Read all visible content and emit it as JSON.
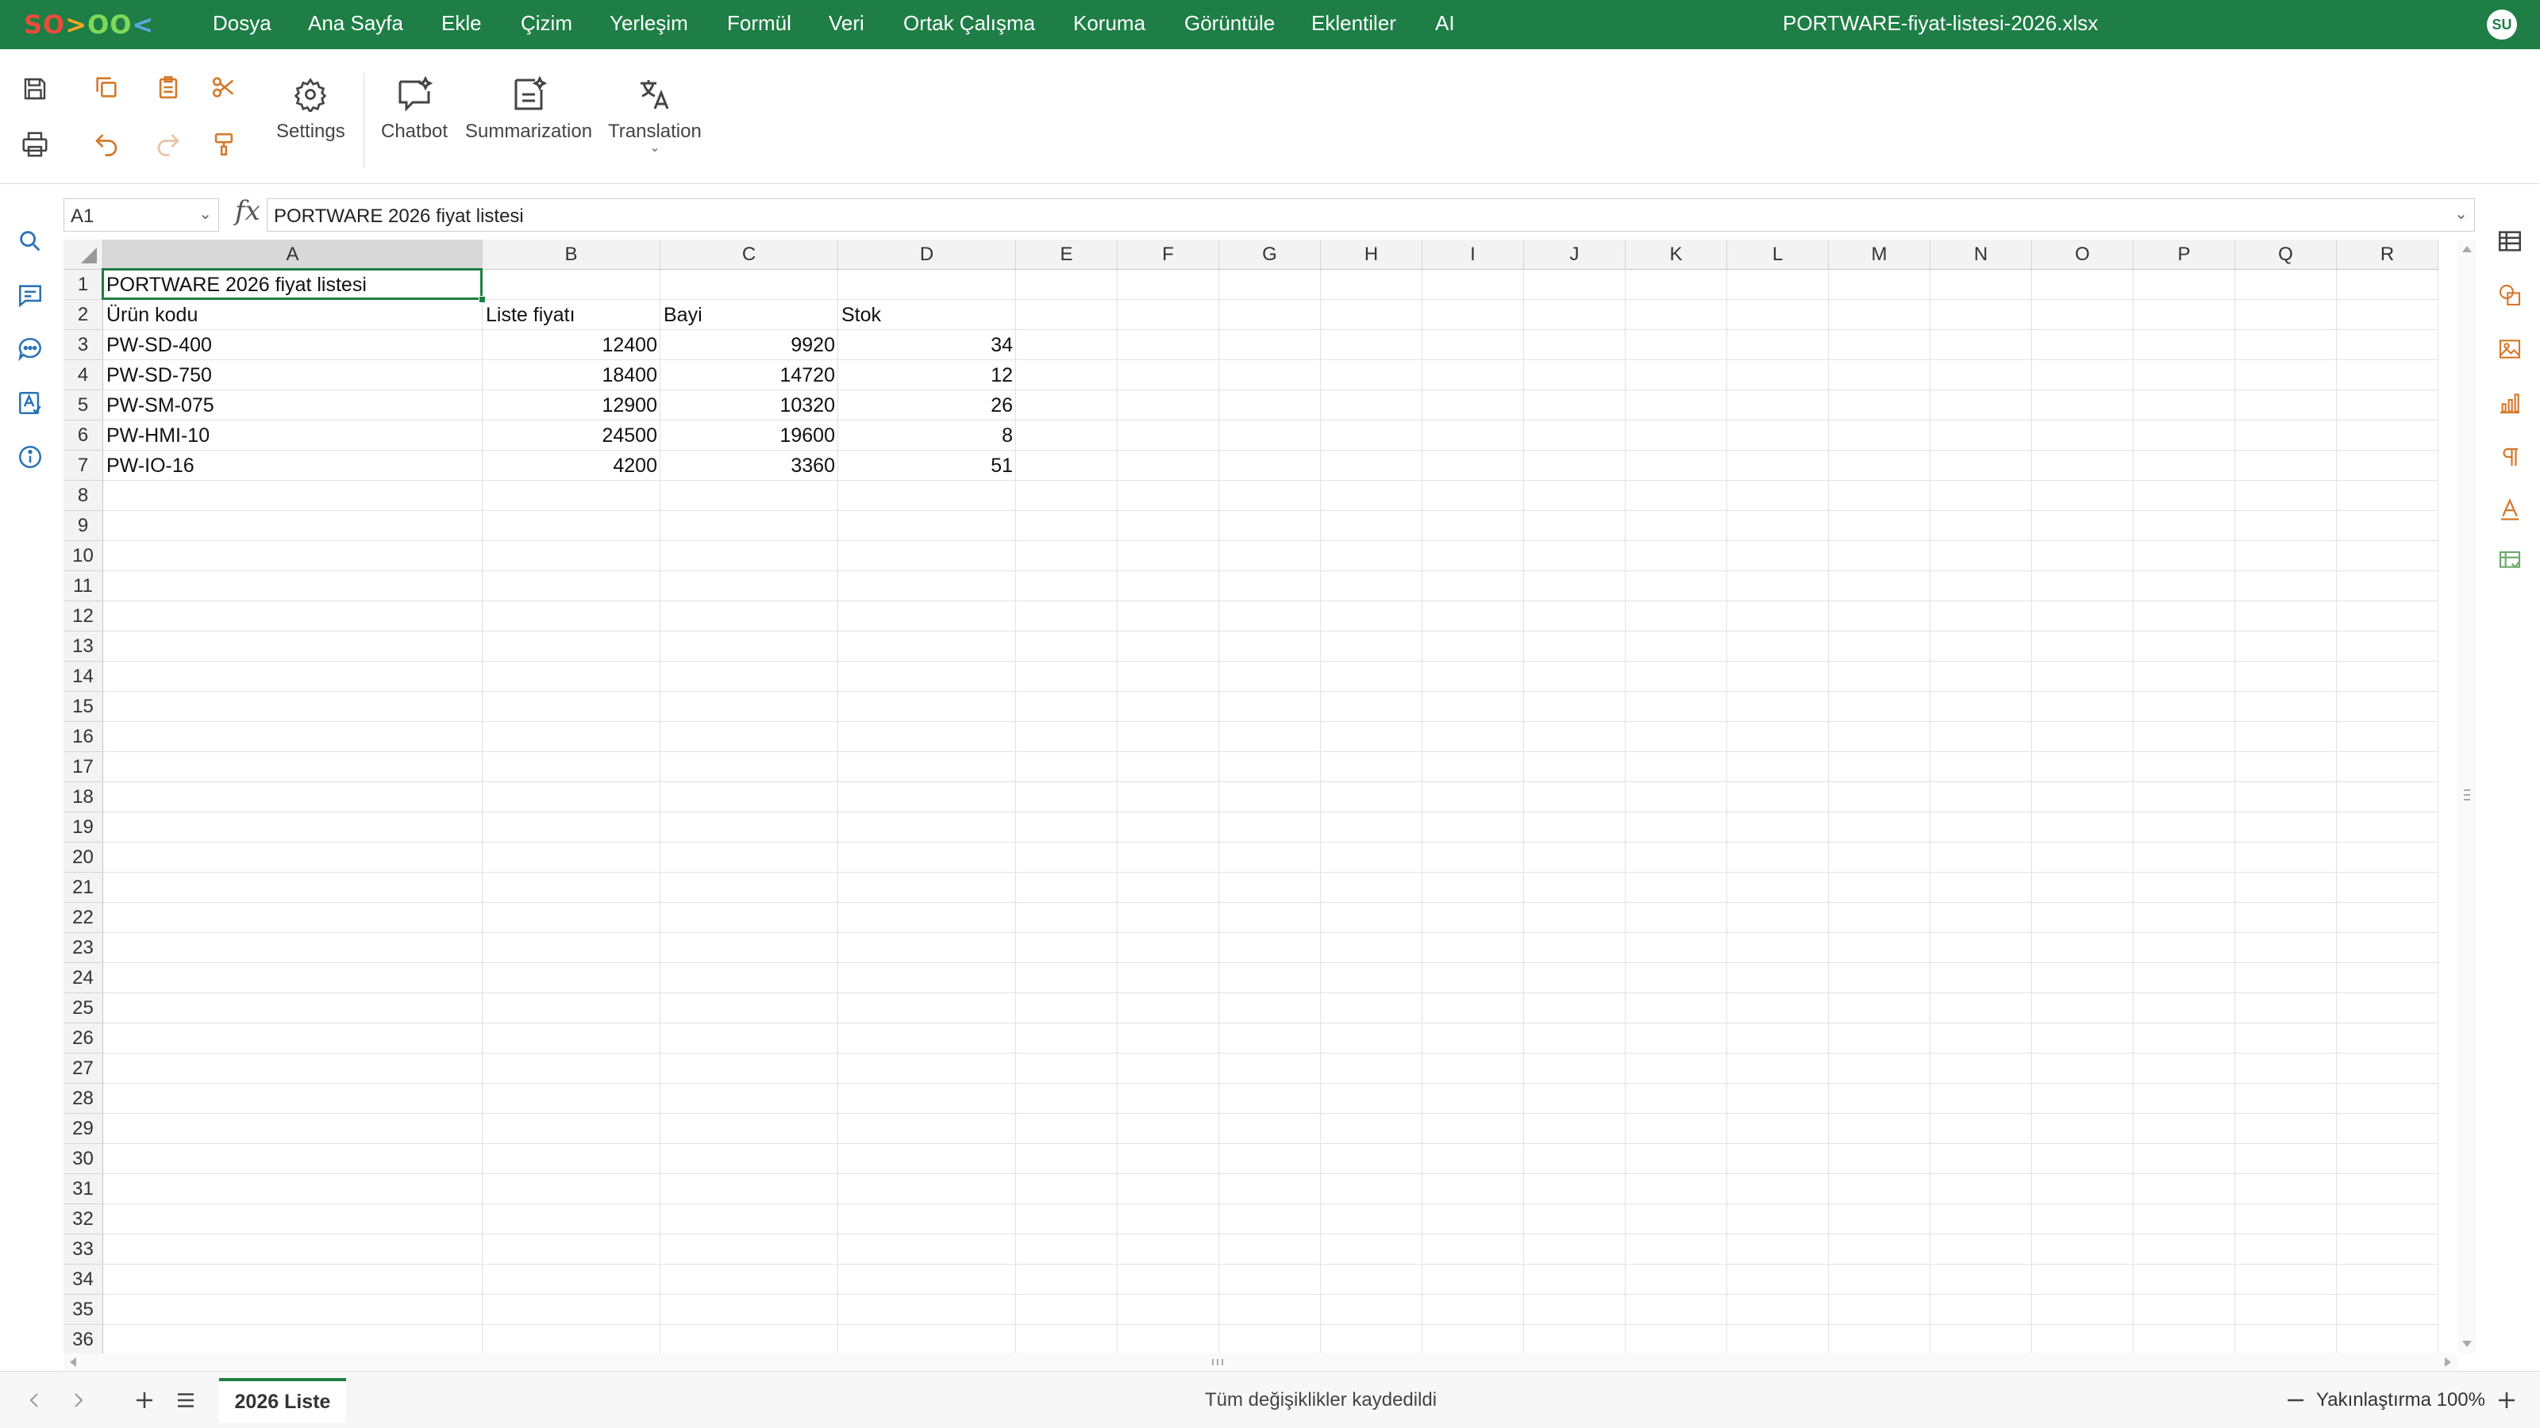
{
  "app": {
    "logo": "SO>OO<",
    "document_title": "PORTWARE-fiyat-listesi-2026.xlsx",
    "user_initials": "SU"
  },
  "menu": [
    "Dosya",
    "Ana Sayfa",
    "Ekle",
    "Çizim",
    "Yerleşim",
    "Formül",
    "Veri",
    "Ortak Çalışma",
    "Koruma",
    "Görüntüle",
    "Eklentiler",
    "AI"
  ],
  "toolbar": {
    "settings_label": "Settings",
    "chatbot_label": "Chatbot",
    "summarization_label": "Summarization",
    "translation_label": "Translation"
  },
  "formula_bar": {
    "name_box": "A1",
    "formula": "PORTWARE 2026 fiyat listesi"
  },
  "sheet": {
    "columns": [
      "A",
      "B",
      "C",
      "D",
      "E",
      "F",
      "G",
      "H",
      "I",
      "J",
      "K",
      "L",
      "M",
      "N",
      "O",
      "P",
      "Q",
      "R"
    ],
    "row_count": 36,
    "selected_cell": "A1",
    "rows": [
      [
        "PORTWARE 2026 fiyat listesi",
        "",
        "",
        ""
      ],
      [
        "Ürün kodu",
        "Liste fiyatı",
        "Bayi",
        "Stok"
      ],
      [
        "PW-SD-400",
        "12400",
        "9920",
        "34"
      ],
      [
        "PW-SD-750",
        "18400",
        "14720",
        "12"
      ],
      [
        "PW-SM-075",
        "12900",
        "10320",
        "26"
      ],
      [
        "PW-HMI-10",
        "24500",
        "19600",
        "8"
      ],
      [
        "PW-IO-16",
        "4200",
        "3360",
        "51"
      ]
    ]
  },
  "status": {
    "sheet_tab": "2026 Liste",
    "save_status": "Tüm değişiklikler kaydedildi",
    "zoom": "Yakınlaştırma 100%"
  },
  "colors": {
    "accent": "#1e7e45"
  }
}
